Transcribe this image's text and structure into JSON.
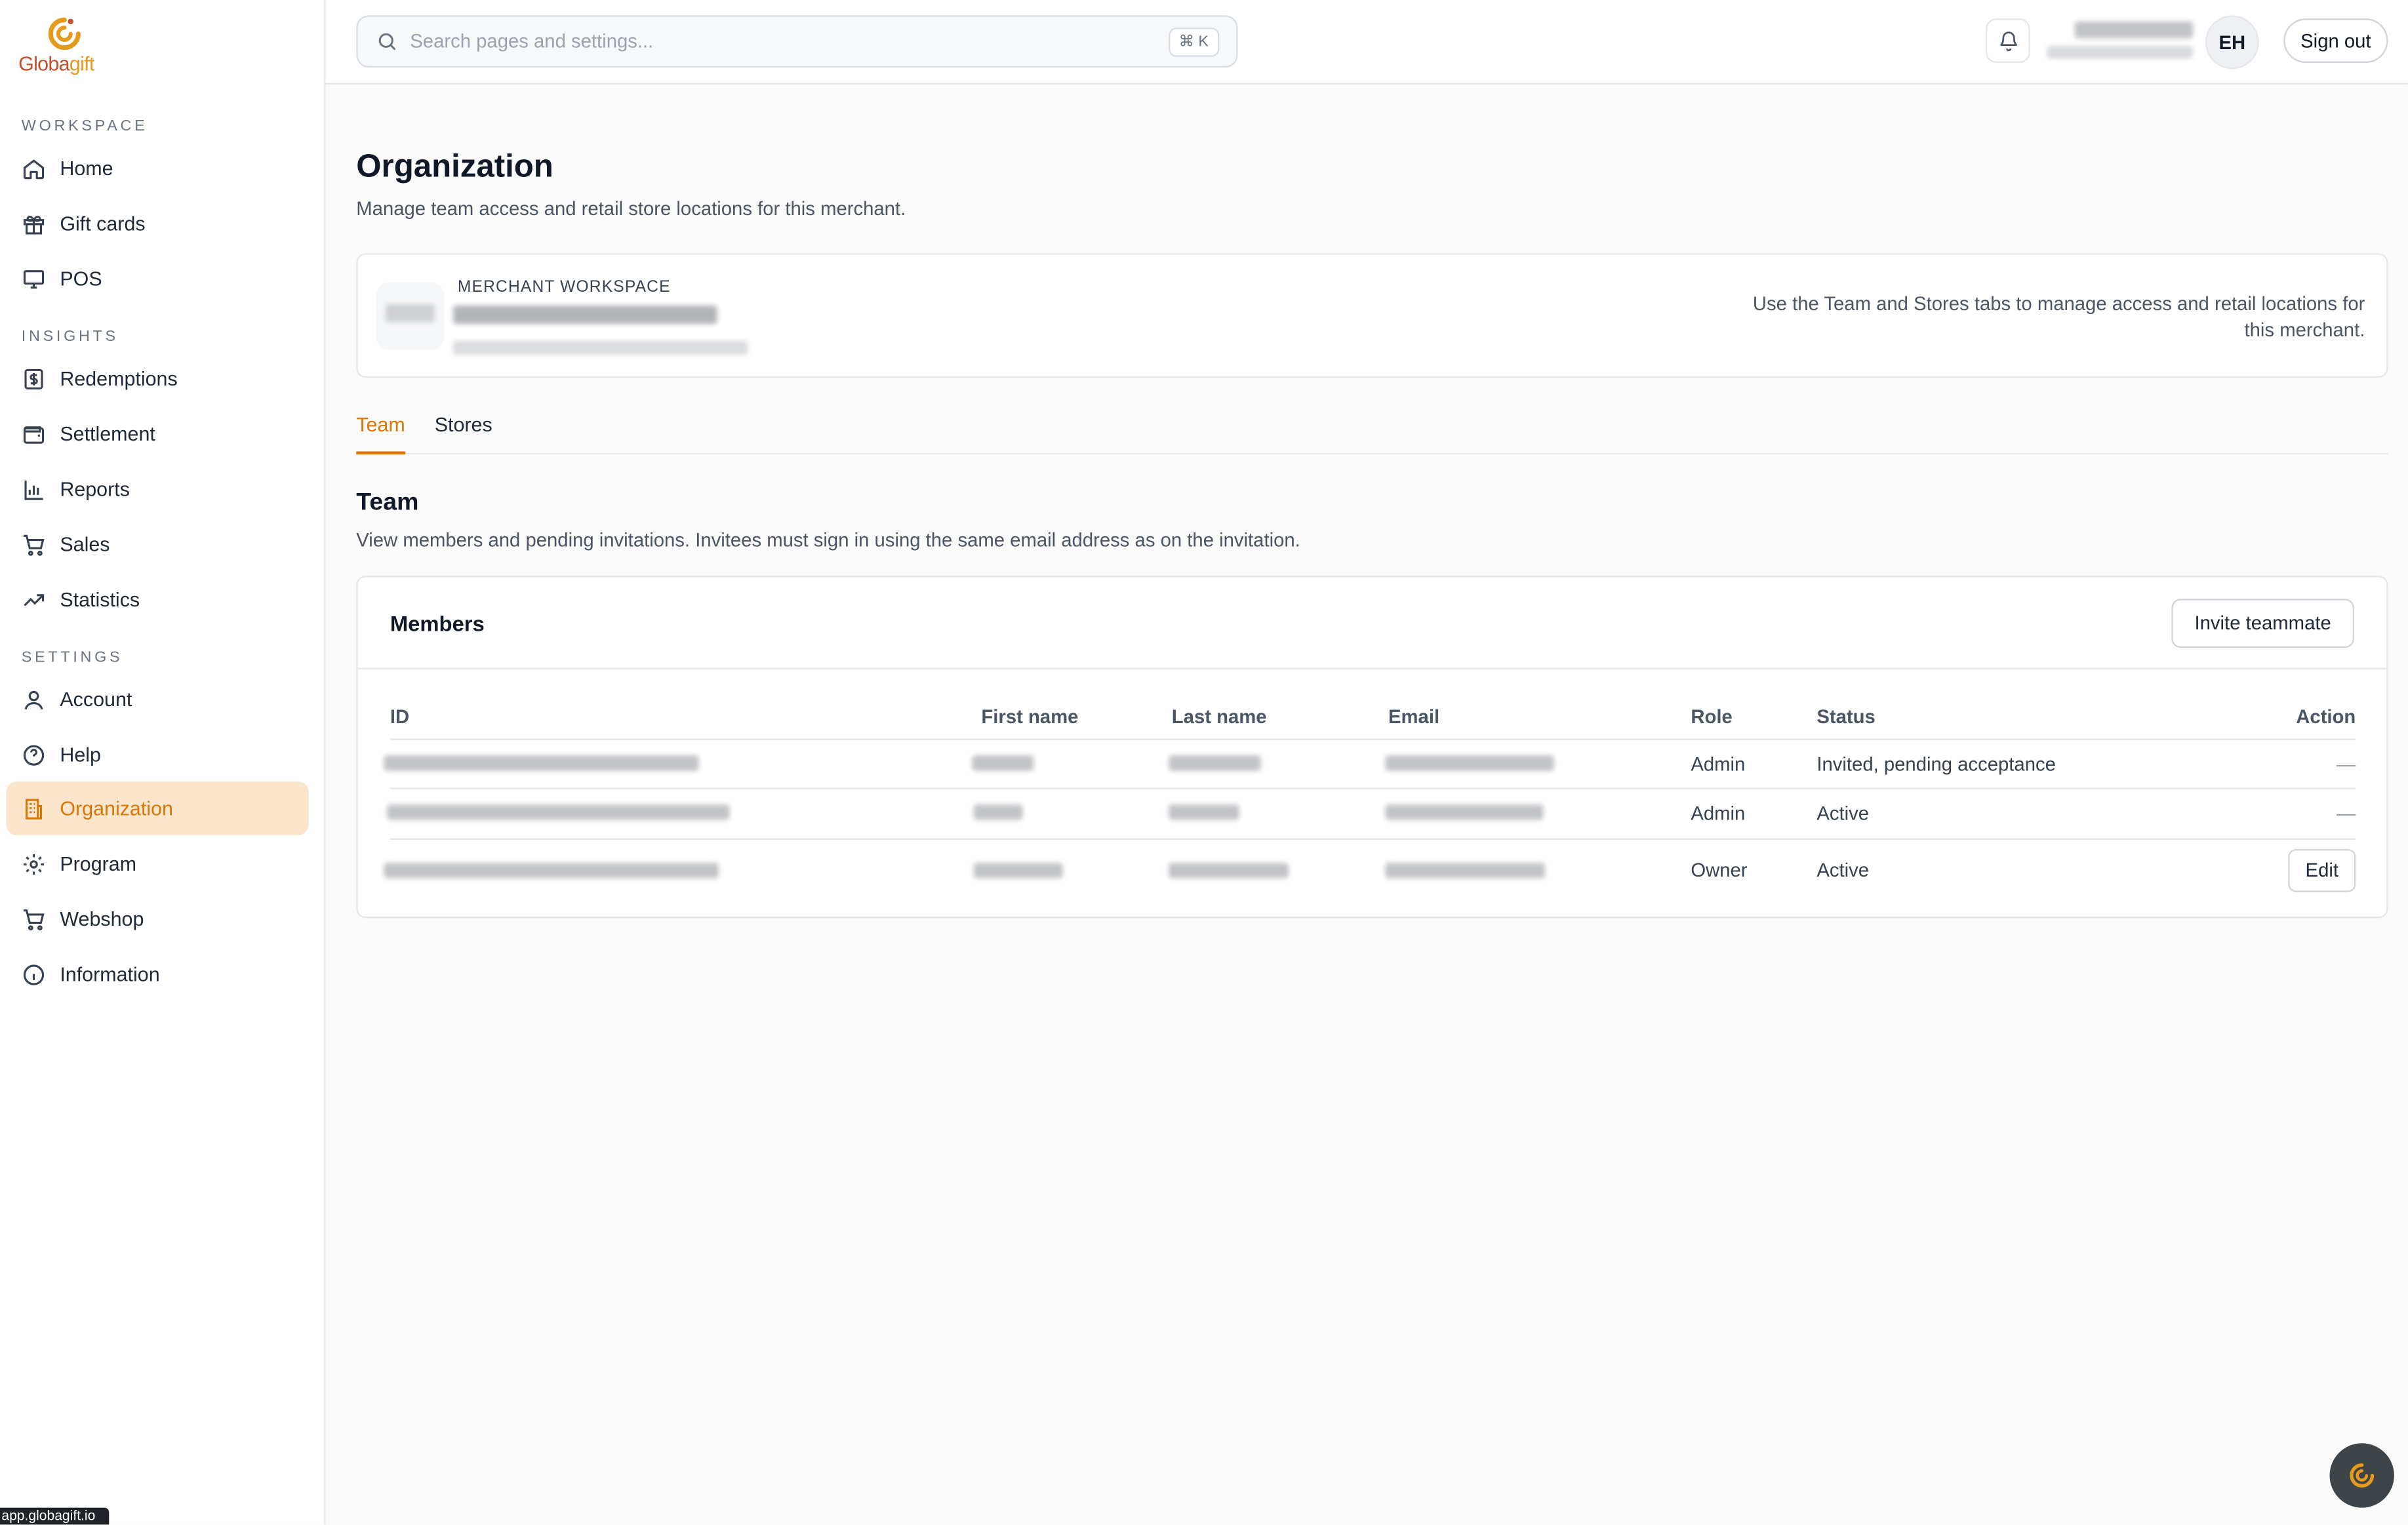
{
  "brand": {
    "logo_text_a": "Globa",
    "logo_text_b": "gift",
    "accent": "#d97706"
  },
  "sidebar": {
    "sections": [
      {
        "label": "WORKSPACE"
      },
      {
        "label": "INSIGHTS"
      },
      {
        "label": "SETTINGS"
      }
    ],
    "items": [
      {
        "label": "Home",
        "icon": "home-icon"
      },
      {
        "label": "Gift cards",
        "icon": "gift-icon"
      },
      {
        "label": "POS",
        "icon": "monitor-icon"
      },
      {
        "label": "Redemptions",
        "icon": "dollar-receipt-icon"
      },
      {
        "label": "Settlement",
        "icon": "wallet-icon"
      },
      {
        "label": "Reports",
        "icon": "bar-chart-icon"
      },
      {
        "label": "Sales",
        "icon": "cart-icon"
      },
      {
        "label": "Statistics",
        "icon": "trend-icon"
      },
      {
        "label": "Account",
        "icon": "user-icon"
      },
      {
        "label": "Help",
        "icon": "help-icon"
      },
      {
        "label": "Organization",
        "icon": "building-icon",
        "active": true
      },
      {
        "label": "Program",
        "icon": "gear-icon"
      },
      {
        "label": "Webshop",
        "icon": "cart-icon"
      },
      {
        "label": "Information",
        "icon": "info-icon"
      }
    ]
  },
  "topbar": {
    "search_placeholder": "Search pages and settings...",
    "search_shortcut": "⌘ K",
    "avatar_initials": "EH",
    "sign_out_label": "Sign out"
  },
  "page": {
    "title": "Organization",
    "subtitle": "Manage team access and retail store locations for this merchant.",
    "merchant_label": "MERCHANT WORKSPACE",
    "merchant_note": "Use the Team and Stores tabs to manage access and retail locations for this merchant.",
    "tabs": [
      {
        "label": "Team",
        "active": true
      },
      {
        "label": "Stores"
      }
    ],
    "section_title": "Team",
    "section_subtitle": "View members and pending invitations. Invitees must sign in using the same email address as on the invitation."
  },
  "members": {
    "title": "Members",
    "invite_label": "Invite teammate",
    "columns": [
      "ID",
      "First name",
      "Last name",
      "Email",
      "Role",
      "Status",
      "Action"
    ],
    "rows": [
      {
        "role": "Admin",
        "status": "Invited, pending acceptance",
        "action": "—"
      },
      {
        "role": "Admin",
        "status": "Active",
        "action": "—"
      },
      {
        "role": "Owner",
        "status": "Active",
        "action": "Edit"
      }
    ]
  },
  "status_tip": "app.globagift.io"
}
